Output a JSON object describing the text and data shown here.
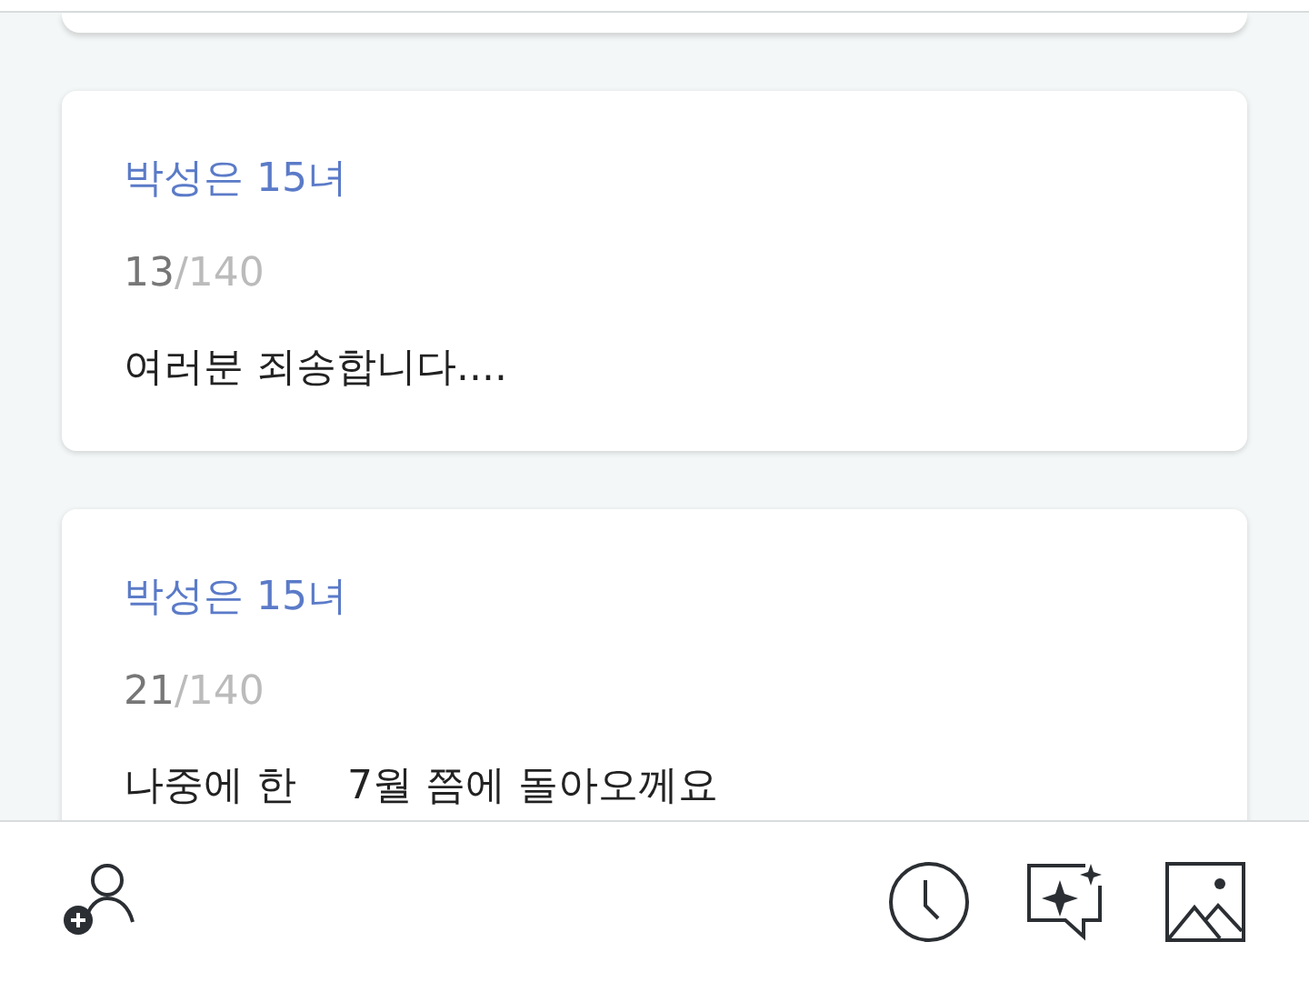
{
  "posts": [
    {
      "author": "박성은 15녀",
      "count": "13",
      "max": "/140",
      "message": "여러분 죄송합니다...."
    },
    {
      "author": "박성은 15녀",
      "count": "21",
      "max": "/140",
      "message": "나중에 한    7월 쯤에 돌아오께요"
    }
  ],
  "toolbar": [
    {
      "kind": "add-user"
    },
    {
      "kind": "spacer"
    },
    {
      "kind": "clock"
    },
    {
      "kind": "sparkle-chat"
    },
    {
      "kind": "image"
    }
  ]
}
